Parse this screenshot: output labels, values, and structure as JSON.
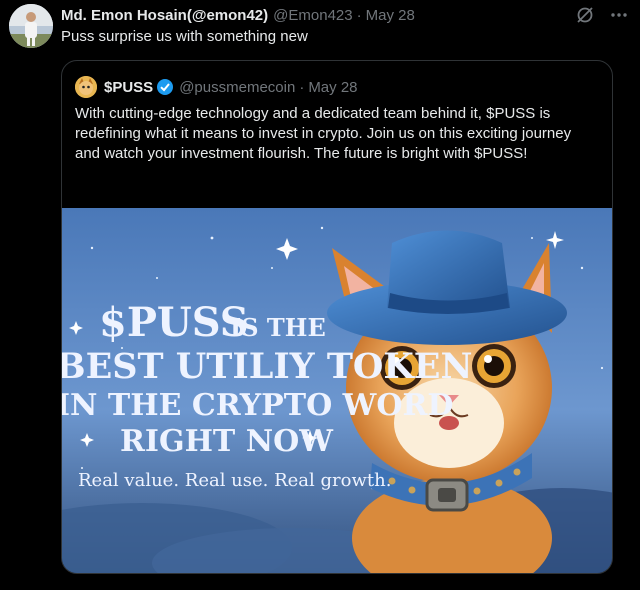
{
  "tweet": {
    "author_name": "Md. Emon Hosain(@emon42)",
    "author_handle": "@Emon423",
    "separator": "·",
    "date": "May 28",
    "text": "Puss surprise us with something new",
    "more_icon": "more-horizontal-icon",
    "grok_icon": "grok-slash-icon"
  },
  "quote": {
    "author_name": "$PUSS",
    "verified_icon": "verified-badge-icon",
    "author_handle": "@pussmemecoin",
    "separator": "·",
    "date": "May 28",
    "text": "With cutting-edge technology and a dedicated team behind it, $PUSS is redefining what it means to invest in crypto. Join us on this exciting journey and watch your investment flourish. The future is bright with $PUSS!",
    "image": {
      "headline_1a": "$PUSS",
      "headline_1b": "IS THE",
      "headline_2": "BEST UTILIY TOKEN",
      "headline_3": "IN THE CRYPTO WORD",
      "headline_4": "RIGHT NOW",
      "tagline": "Real value. Real use. Real growth."
    }
  },
  "colors": {
    "background": "#000000",
    "text_primary": "#e7e9ea",
    "text_secondary": "#71767b",
    "border": "#2f3336",
    "verified_blue": "#1d9bf0"
  }
}
